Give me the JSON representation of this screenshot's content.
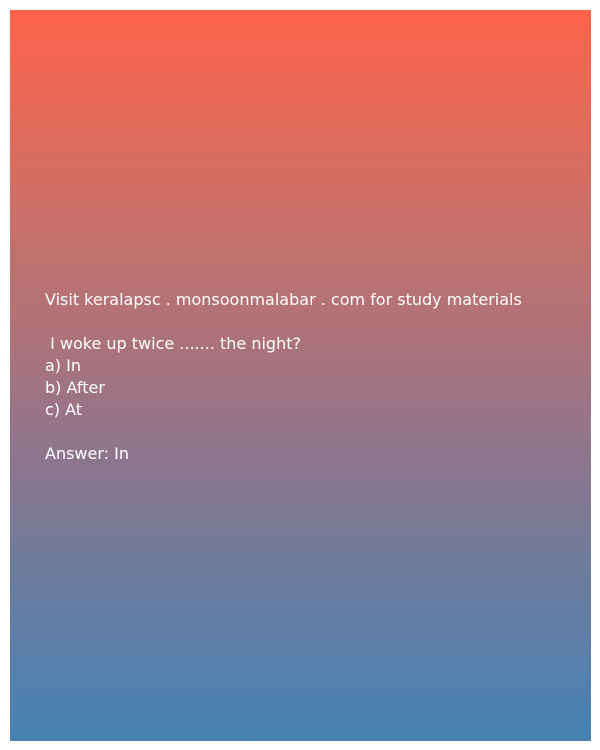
{
  "card": {
    "gradient_top": "#ff634a",
    "gradient_bottom": "#4682b4",
    "text_color": "#ffffff"
  },
  "promo": {
    "text": "Visit keralapsc . monsoonmalabar . com for study materials"
  },
  "question": {
    "text": " I woke up twice ....... the night?",
    "options": [
      "a) In",
      "b) After",
      "c) At"
    ]
  },
  "answer": {
    "text": "Answer: In"
  }
}
